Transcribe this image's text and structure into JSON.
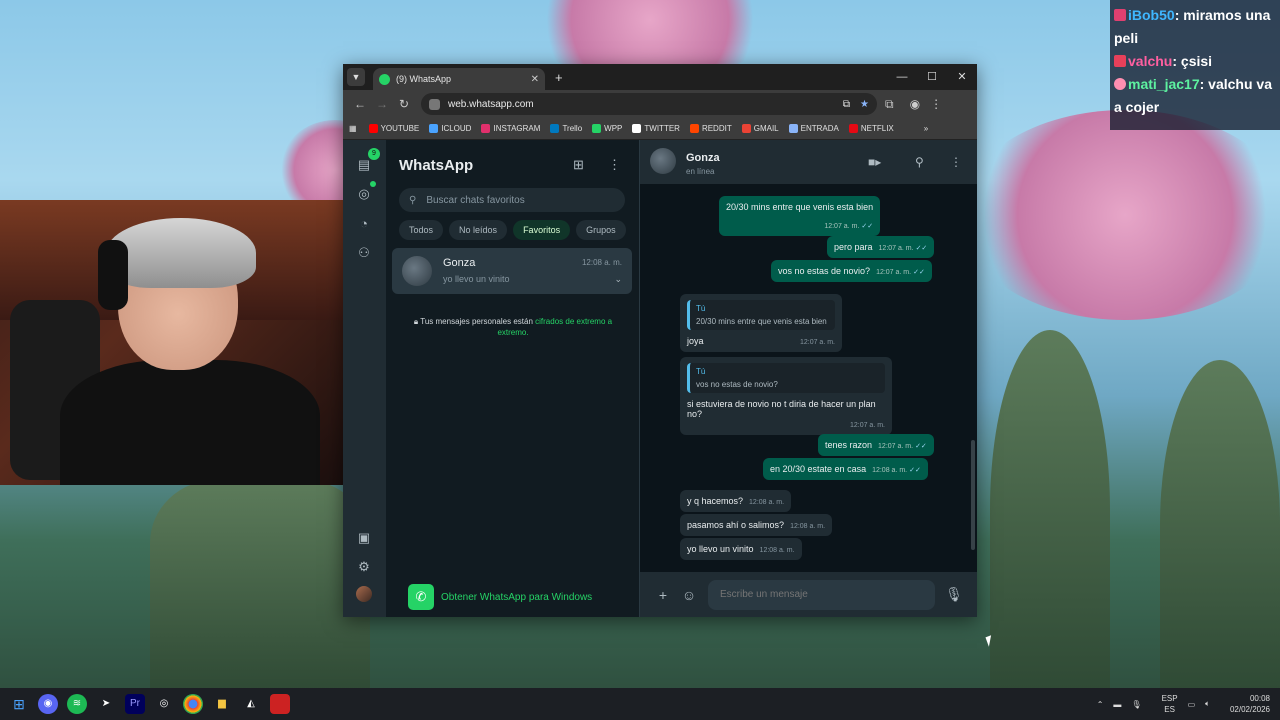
{
  "stream_chat": [
    {
      "user": "iBob50",
      "message": "miramos una peli"
    },
    {
      "user": "valchu",
      "message": "çsisi"
    },
    {
      "user": "mati_jac17",
      "message": "valchu va a cojer"
    }
  ],
  "browser": {
    "tab_title": "(9) WhatsApp",
    "url": "web.whatsapp.com",
    "bookmarks": [
      "YOUTUBE",
      "ICLOUD",
      "INSTAGRAM",
      "Trello",
      "WPP",
      "TWITTER",
      "REDDIT",
      "GMAIL",
      "ENTRADA",
      "NETFLIX"
    ],
    "bookmark_colors": [
      "#ff0000",
      "#4aa3ff",
      "#e1306c",
      "#0079bf",
      "#25d366",
      "#ffffff",
      "#ff4500",
      "#ea4335",
      "#8ab4f8",
      "#e50914"
    ]
  },
  "whatsapp": {
    "unread_badge": "9",
    "title": "WhatsApp",
    "search_placeholder": "Buscar chats favoritos",
    "filters": [
      "Todos",
      "No leídos",
      "Favoritos",
      "Grupos"
    ],
    "active_filter": "Favoritos",
    "chat": {
      "name": "Gonza",
      "time": "12:08 a. m.",
      "preview": "yo llevo un vinito"
    },
    "encryption_note": "Tus mensajes personales están",
    "encryption_link": "cifrados de extremo a extremo.",
    "get_app": "Obtener WhatsApp para Windows",
    "contact": {
      "name": "Gonza",
      "status": "en línea"
    },
    "compose_placeholder": "Escribe un mensaje",
    "messages": [
      {
        "dir": "out",
        "text": "20/30 mins entre que venis esta bien",
        "time": "12:07 a. m."
      },
      {
        "dir": "out",
        "text": "pero para",
        "time": "12:07 a. m."
      },
      {
        "dir": "out",
        "text": "vos no estas de novio?",
        "time": "12:07 a. m."
      },
      {
        "dir": "in",
        "quote_name": "Tú",
        "quote": "20/30 mins entre que venis esta bien",
        "text": "joya",
        "time": "12:07 a. m."
      },
      {
        "dir": "in",
        "quote_name": "Tú",
        "quote": "vos no estas de novio?",
        "text": "si estuviera de novio no t diria de hacer un plan no?",
        "time": "12:07 a. m."
      },
      {
        "dir": "out",
        "text": "tenes razon",
        "time": "12:07 a. m."
      },
      {
        "dir": "out",
        "text": "en 20/30 estate en casa",
        "time": "12:08 a. m."
      },
      {
        "dir": "in",
        "text": "y q hacemos?",
        "time": "12:08 a. m."
      },
      {
        "dir": "in",
        "text": "pasamos ahí o salimos?",
        "time": "12:08 a. m."
      },
      {
        "dir": "in",
        "text": "yo llevo un vinito",
        "time": "12:08 a. m."
      }
    ]
  },
  "taskbar": {
    "lang_top": "ESP",
    "lang_bottom": "ES",
    "time": "00:08",
    "date": "02/02/2026"
  }
}
